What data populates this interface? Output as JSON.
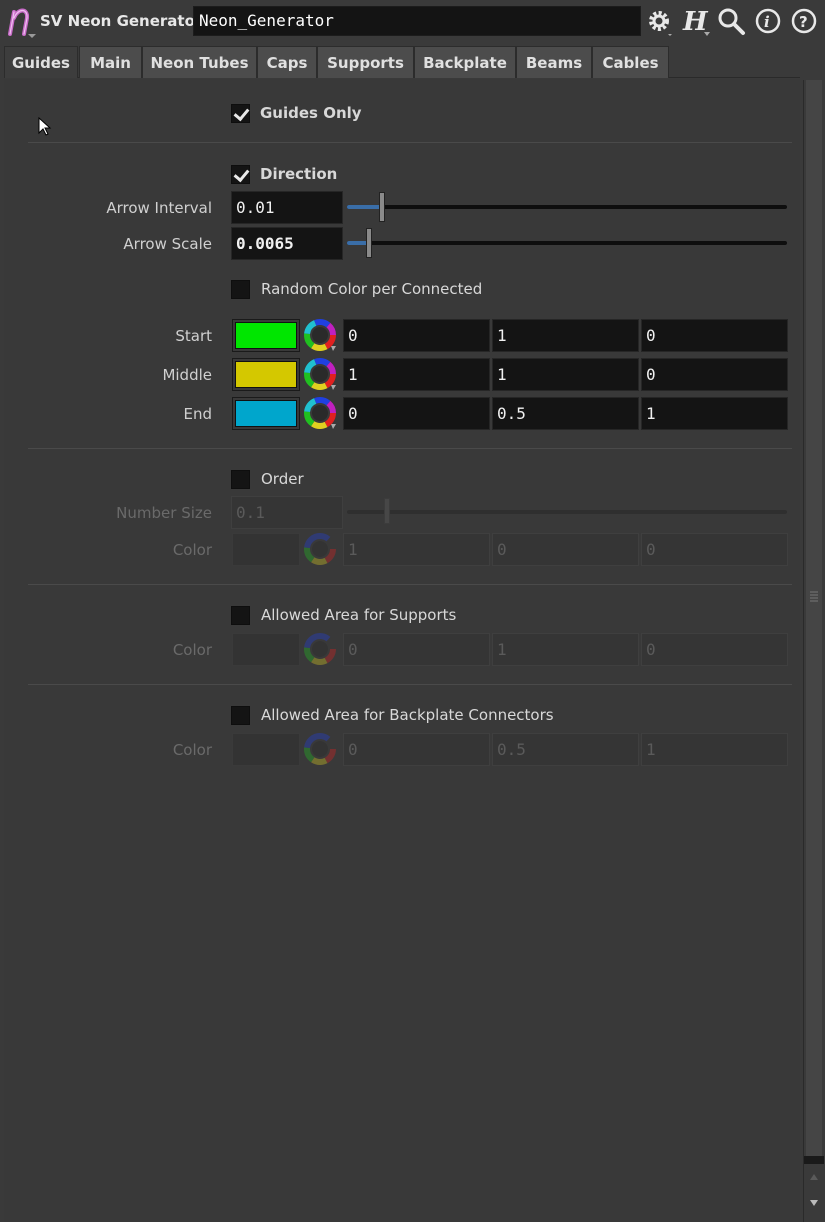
{
  "header": {
    "node_type": "SV Neon Generator",
    "node_name": "Neon_Generator",
    "icons": [
      "gear-icon",
      "houdini-help-icon",
      "search-icon",
      "info-icon",
      "question-icon"
    ]
  },
  "tabs": [
    {
      "label": "Guides",
      "active": true
    },
    {
      "label": "Main"
    },
    {
      "label": "Neon Tubes"
    },
    {
      "label": "Caps"
    },
    {
      "label": "Supports"
    },
    {
      "label": "Backplate"
    },
    {
      "label": "Beams"
    },
    {
      "label": "Cables"
    }
  ],
  "guides_only": {
    "label": "Guides Only",
    "checked": true
  },
  "direction": {
    "label": "Direction",
    "checked": true,
    "arrow_interval": {
      "label": "Arrow Interval",
      "value": "0.01",
      "fraction": 0.08
    },
    "arrow_scale": {
      "label": "Arrow Scale",
      "value": "0.0065",
      "fraction": 0.05
    }
  },
  "random_color": {
    "label": "Random Color per Connected",
    "checked": false
  },
  "colors": {
    "start": {
      "label": "Start",
      "swatch": "#00e600",
      "r": "0",
      "g": "1",
      "b": "0"
    },
    "middle": {
      "label": "Middle",
      "swatch": "#d4c800",
      "r": "1",
      "g": "1",
      "b": "0"
    },
    "end": {
      "label": "End",
      "swatch": "#00a6cc",
      "r": "0",
      "g": "0.5",
      "b": "1"
    }
  },
  "order": {
    "label": "Order",
    "checked": false,
    "number_size": {
      "label": "Number Size",
      "value": "0.1",
      "fraction": 0.09
    },
    "color": {
      "label": "Color",
      "r": "1",
      "g": "0",
      "b": "0"
    }
  },
  "supports_area": {
    "label": "Allowed Area for Supports",
    "checked": false,
    "color": {
      "label": "Color",
      "r": "0",
      "g": "1",
      "b": "0"
    }
  },
  "backplate_area": {
    "label": "Allowed Area for Backplate Connectors",
    "checked": false,
    "color": {
      "label": "Color",
      "r": "0",
      "g": "0.5",
      "b": "1"
    }
  }
}
